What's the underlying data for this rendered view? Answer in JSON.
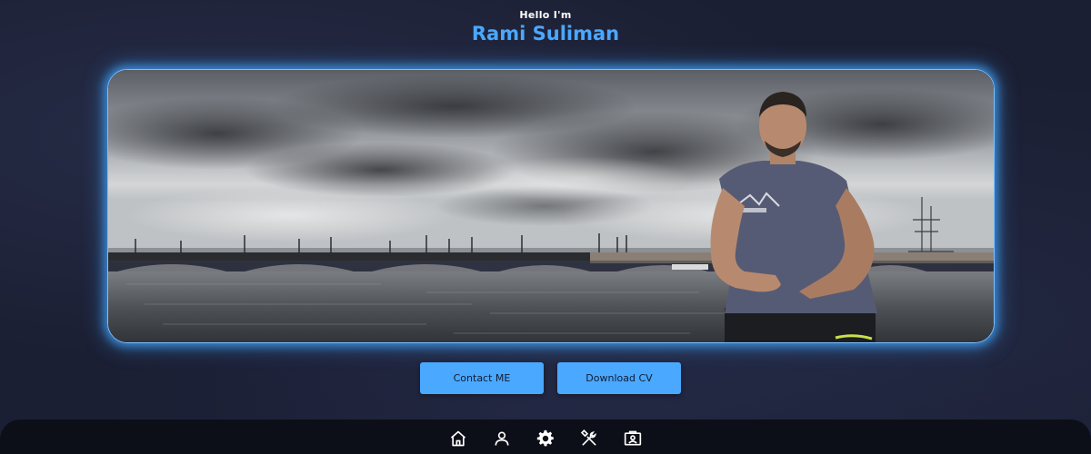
{
  "header": {
    "greeting": "Hello I'm",
    "name": "Rami Suliman"
  },
  "buttons": {
    "contact": "Contact ME",
    "download_cv": "Download CV"
  },
  "colors": {
    "accent": "#4aa8ff",
    "background": "#1b1f33",
    "nav_background": "#0d0f18"
  },
  "nav": {
    "items": [
      {
        "icon": "home-icon"
      },
      {
        "icon": "user-icon"
      },
      {
        "icon": "gear-icon"
      },
      {
        "icon": "tools-icon"
      },
      {
        "icon": "portfolio-icon"
      }
    ]
  }
}
